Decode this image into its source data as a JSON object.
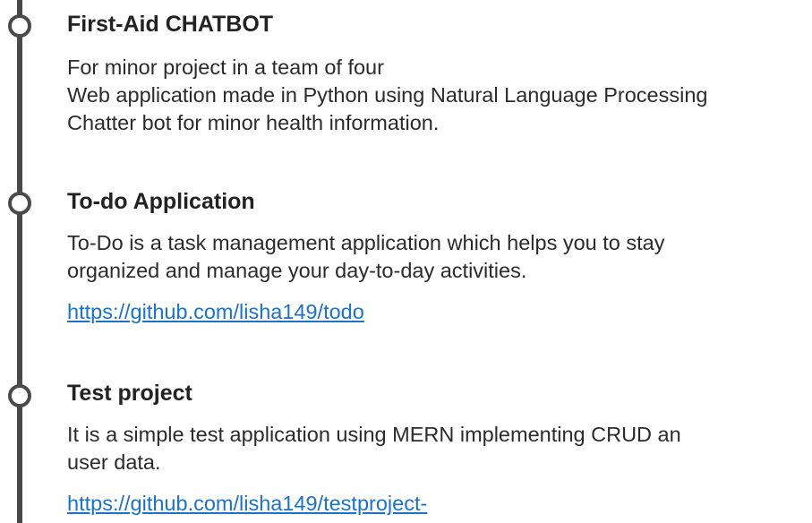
{
  "projects": [
    {
      "title": "First-Aid CHATBOT",
      "description_lines": [
        "For minor project in a team of four",
        "Web application made in Python using Natural Language Processing",
        "Chatter bot for minor health information."
      ]
    },
    {
      "title": "To-do Application",
      "description_lines": [
        "To-Do is a task management application which helps you to stay",
        "organized and manage your day-to-day activities."
      ],
      "link": "https://github.com/lisha149/todo"
    },
    {
      "title": "Test project",
      "description_lines": [
        "It is a simple test application using MERN implementing CRUD an",
        "user data."
      ],
      "link": "https://github.com/lisha149/testproject-"
    }
  ],
  "icons": {
    "timeline_node": "circle-outline-icon"
  },
  "colors": {
    "timeline": "#4a4a4a",
    "link": "#1a73c9",
    "text": "#2b2b2b"
  }
}
